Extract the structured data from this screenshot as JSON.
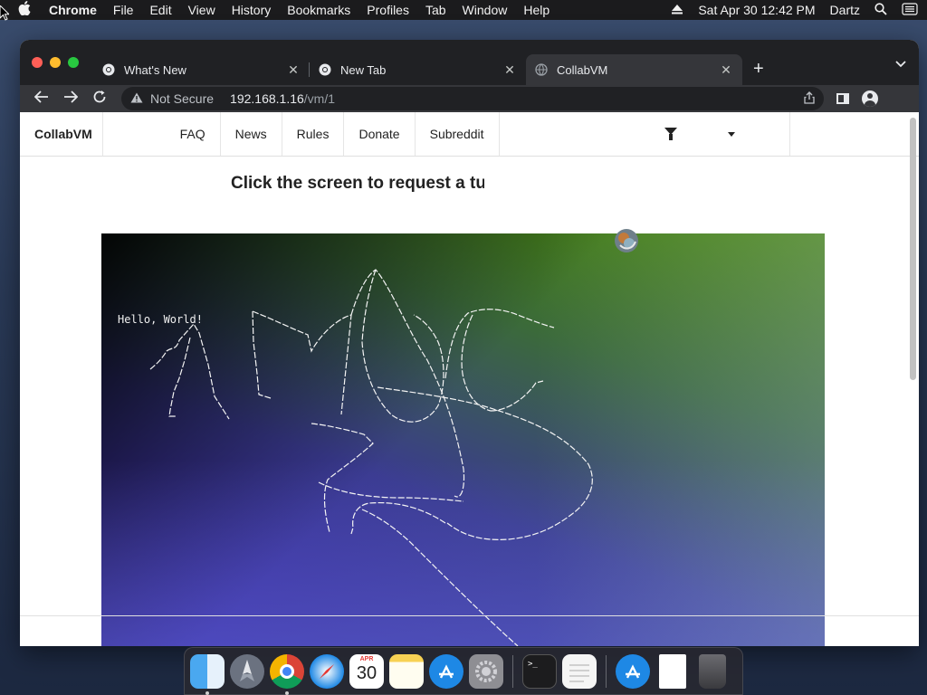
{
  "menubar": {
    "app_name": "Chrome",
    "menus": [
      "File",
      "Edit",
      "View",
      "History",
      "Bookmarks",
      "Profiles",
      "Tab",
      "Window",
      "Help"
    ],
    "datetime": "Sat Apr 30  12:42 PM",
    "user": "Dartz"
  },
  "browser": {
    "tabs": [
      {
        "title": "What's New",
        "active": false
      },
      {
        "title": "New Tab",
        "active": false
      },
      {
        "title": "CollabVM",
        "active": true
      }
    ],
    "address": {
      "security_label": "Not Secure",
      "host": "192.168.1.16",
      "path": "/vm/1"
    }
  },
  "site": {
    "brand": "CollabVM",
    "nav": [
      "FAQ",
      "News",
      "Rules",
      "Donate",
      "Subreddit"
    ],
    "turn_message": "Click the screen to request a turn"
  },
  "vm": {
    "text": "Hello, World!",
    "colors": {
      "top_left": "#000000",
      "top_right": "#4a8c00",
      "bottom_left": "#3a1fb0",
      "bottom_right": "#6a78d0"
    }
  },
  "dock": {
    "apps": [
      "finder-icon",
      "launchpad-icon",
      "chrome-icon",
      "safari-icon",
      "calendar-icon",
      "notes-icon",
      "app-store-icon",
      "system-preferences-icon",
      "terminal-icon",
      "textedit-icon",
      "app-store-icon",
      "document-icon",
      "trash-icon"
    ],
    "calendar_month": "APR",
    "calendar_day": "30"
  }
}
